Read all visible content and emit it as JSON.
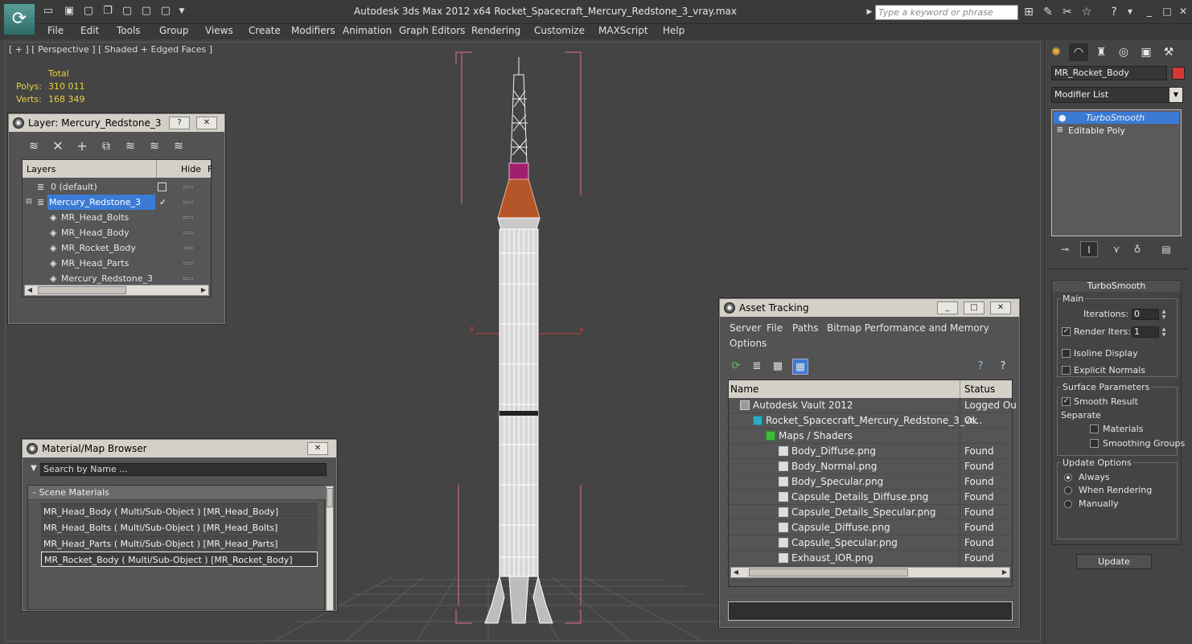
{
  "app": {
    "title": "Autodesk 3ds Max  2012 x64      Rocket_Spacecraft_Mercury_Redstone_3_vray.max",
    "search_placeholder": "Type a keyword or phrase"
  },
  "menu": [
    "File",
    "Edit",
    "Tools",
    "Group",
    "Views",
    "Create",
    "Modifiers",
    "Animation",
    "Graph Editors",
    "Rendering",
    "Customize",
    "MAXScript",
    "Help"
  ],
  "viewport": {
    "label": "[ + ] [ Perspective ] [ Shaded + Edged Faces ]",
    "stats": {
      "header": "Total",
      "polys_label": "Polys:",
      "polys": "310 011",
      "verts_label": "Verts:",
      "verts": "168 349"
    },
    "axis_x": "x",
    "axis_y": "y"
  },
  "layer_window": {
    "title": "Layer: Mercury_Redstone_3",
    "col_layers": "Layers",
    "col_hide": "Hide",
    "col_f": "F",
    "rows": [
      {
        "name": "0 (default)",
        "level": 0
      },
      {
        "name": "Mercury_Redstone_3",
        "level": 0
      },
      {
        "name": "MR_Head_Bolts",
        "level": 1
      },
      {
        "name": "MR_Head_Body",
        "level": 1
      },
      {
        "name": "MR_Rocket_Body",
        "level": 1
      },
      {
        "name": "MR_Head_Parts",
        "level": 1
      },
      {
        "name": "Mercury_Redstone_3",
        "level": 1
      }
    ],
    "selected_index": 1
  },
  "material_browser": {
    "title": "Material/Map Browser",
    "search_placeholder": "Search by Name ...",
    "group_label": "- Scene Materials",
    "items": [
      "MR_Head_Body  ( Multi/Sub-Object ) [MR_Head_Body]",
      "MR_Head_Bolts  ( Multi/Sub-Object ) [MR_Head_Bolts]",
      "MR_Head_Parts  ( Multi/Sub-Object ) [MR_Head_Parts]",
      "MR_Rocket_Body  ( Multi/Sub-Object ) [MR_Rocket_Body]"
    ],
    "selected_index": 3
  },
  "asset_tracking": {
    "title": "Asset Tracking",
    "menu": [
      "Server",
      "File",
      "Paths",
      "Bitmap Performance and Memory",
      "Options"
    ],
    "col_name": "Name",
    "col_status": "Status",
    "rows": [
      {
        "name": "Autodesk Vault 2012",
        "status": "Logged Ou",
        "indent": 1
      },
      {
        "name": "Rocket_Spacecraft_Mercury_Redstone_3_vr...",
        "status": "Ok",
        "indent": 2
      },
      {
        "name": "Maps / Shaders",
        "status": "",
        "indent": 3
      },
      {
        "name": "Body_Diffuse.png",
        "status": "Found",
        "indent": 4
      },
      {
        "name": "Body_Normal.png",
        "status": "Found",
        "indent": 4
      },
      {
        "name": "Body_Specular.png",
        "status": "Found",
        "indent": 4
      },
      {
        "name": "Capsule_Details_Diffuse.png",
        "status": "Found",
        "indent": 4
      },
      {
        "name": "Capsule_Details_Specular.png",
        "status": "Found",
        "indent": 4
      },
      {
        "name": "Capsule_Diffuse.png",
        "status": "Found",
        "indent": 4
      },
      {
        "name": "Capsule_Specular.png",
        "status": "Found",
        "indent": 4
      },
      {
        "name": "Exhaust_IOR.png",
        "status": "Found",
        "indent": 4
      }
    ]
  },
  "command_panel": {
    "object_name": "MR_Rocket_Body",
    "object_color": "#d93535",
    "modifier_list": "Modifier List",
    "stack": [
      "TurboSmooth",
      "Editable Poly"
    ],
    "turbosmooth": {
      "title": "TurboSmooth",
      "main": "Main",
      "iterations_label": "Iterations:",
      "iterations": "0",
      "render_iters_label": "Render Iters:",
      "render_iters": "1",
      "render_iters_checked": true,
      "isoline": "Isoline Display",
      "explicit_normals": "Explicit Normals",
      "surface": "Surface Parameters",
      "smooth_result": "Smooth Result",
      "separate": "Separate",
      "materials": "Materials",
      "smoothing_groups": "Smoothing Groups",
      "update_options": "Update Options",
      "always": "Always",
      "when_rendering": "When Rendering",
      "manually": "Manually",
      "update": "Update"
    }
  }
}
